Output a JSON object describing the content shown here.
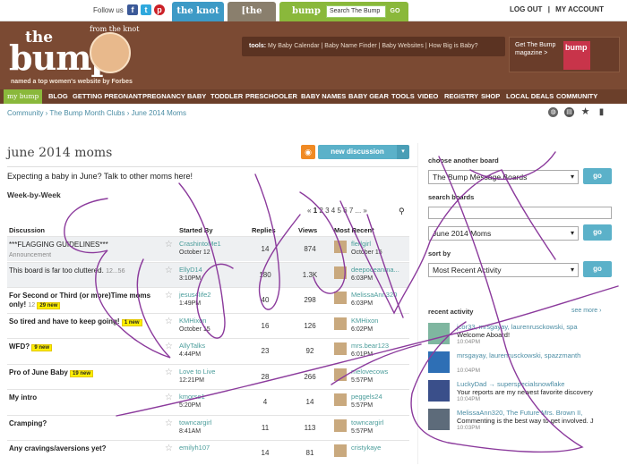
{
  "topbar": {
    "follow_us": "Follow us",
    "tabs": [
      "the knot",
      "[the nest]",
      "bump"
    ],
    "search_placeholder": "Search The Bump",
    "go": "GO",
    "logout": "LOG OUT",
    "sep": "|",
    "my_account": "MY ACCOUNT"
  },
  "header": {
    "logo_the": "the",
    "logo_bump": "bump",
    "from": "from",
    "the_knot": "the knot",
    "tagline": "named a top women's website by Forbes",
    "tools_label": "tools:",
    "tools_links": "My Baby Calendar | Baby Name Finder | Baby Websites | How Big is Baby?",
    "get_bump": "Get The Bump magazine >",
    "mag_label": "bump"
  },
  "nav": [
    "my bump",
    "BLOG",
    "GETTING PREGNANT",
    "PREGNANCY",
    "BABY",
    "TODDLER",
    "PRESCHOOLER",
    "BABY NAMES",
    "BABY GEAR",
    "TOOLS",
    "VIDEO",
    "REGISTRY",
    "SHOP",
    "LOCAL DEALS",
    "COMMUNITY"
  ],
  "breadcrumb": {
    "items": [
      "Community",
      "The Bump Month Clubs",
      "June 2014 Moms"
    ],
    "sep": " › "
  },
  "page": {
    "title": "june 2014 moms",
    "new_discussion": "new discussion",
    "tagline": "Expecting a baby in June? Talk to other moms here!",
    "week_by_week": "Week-by-Week"
  },
  "pager": {
    "prev": "«",
    "pages": [
      "1",
      "2",
      "3",
      "4",
      "5",
      "6",
      "7",
      "..."
    ],
    "next": "»"
  },
  "table": {
    "headers": [
      "Discussion",
      "Started By",
      "Replies",
      "Views",
      "Most Recent"
    ],
    "rows": [
      {
        "title": "***FLAGGING GUIDELINES***",
        "sub": "Announcement",
        "pages": "",
        "badge": "",
        "user": "CrashintoMe1",
        "date": "October 12",
        "replies": "14",
        "views": "874",
        "last_user": "flerlgirl",
        "last_date": "October 15",
        "shade": true,
        "bold": false
      },
      {
        "title": "This board is far too cluttered.",
        "sub": "",
        "pages": "12...56",
        "badge": "",
        "user": "EllyD14",
        "date": "3:10PM",
        "replies": "180",
        "views": "1.3K",
        "last_user": "deepoceanma...",
        "last_date": "6:03PM",
        "shade": true,
        "bold": false
      },
      {
        "title": "For Second or Third (or more)Time moms only!",
        "sub": "",
        "pages": "12",
        "badge": "29 new",
        "user": "jesus4life2",
        "date": "1:49PM",
        "replies": "40",
        "views": "298",
        "last_user": "MelissaAnn320",
        "last_date": "6:03PM",
        "shade": false,
        "bold": true
      },
      {
        "title": "So tired and have to keep going!",
        "sub": "",
        "pages": "",
        "badge": "1 new",
        "user": "KMHixon",
        "date": "October 15",
        "replies": "16",
        "views": "126",
        "last_user": "KMHixon",
        "last_date": "6:02PM",
        "shade": false,
        "bold": true
      },
      {
        "title": "WFD?",
        "sub": "",
        "pages": "",
        "badge": "9 new",
        "user": "AllyTalks",
        "date": "4:44PM",
        "replies": "23",
        "views": "92",
        "last_user": "mrs.bear123",
        "last_date": "6:01PM",
        "shade": false,
        "bold": true
      },
      {
        "title": "Pro of June Baby",
        "sub": "",
        "pages": "",
        "badge": "19 new",
        "user": "Love to Live",
        "date": "12:21PM",
        "replies": "28",
        "views": "266",
        "last_user": "melovecows",
        "last_date": "5:57PM",
        "shade": false,
        "bold": true
      },
      {
        "title": "My intro",
        "sub": "",
        "pages": "",
        "badge": "",
        "user": "kmorse1",
        "date": "5:20PM",
        "replies": "4",
        "views": "14",
        "last_user": "peggels24",
        "last_date": "5:57PM",
        "shade": false,
        "bold": true
      },
      {
        "title": "Cramping?",
        "sub": "",
        "pages": "",
        "badge": "",
        "user": "towncargirl",
        "date": "8:41AM",
        "replies": "11",
        "views": "113",
        "last_user": "towncargirl",
        "last_date": "5:57PM",
        "shade": false,
        "bold": true
      },
      {
        "title": "Any cravings/aversions yet?",
        "sub": "",
        "pages": "",
        "badge": "",
        "user": "emilyh107",
        "date": "",
        "replies": "14",
        "views": "81",
        "last_user": "cristykaye",
        "last_date": "",
        "shade": false,
        "bold": true
      }
    ]
  },
  "sidebar": {
    "choose_board": "choose another board",
    "board_value": "The Bump Message Boards",
    "search_boards": "search boards",
    "search_board_value": "June 2014 Moms",
    "sort_by": "sort by",
    "sort_value": "Most Recent Activity",
    "go": "go",
    "recent_activity": "recent activity",
    "see_more": "see more ›",
    "activity": [
      {
        "who": "jcor33, mrsgayay, laurenrusckowski, spa",
        "msg": "Welcome Aboard!",
        "date": "10:04PM"
      },
      {
        "who": "mrsgayay, laurenrusckowski, spazzmanth",
        "msg": "",
        "date": "10:04PM"
      },
      {
        "who": "LuckyDad → superspecialsnowflake",
        "msg": "Your reports are my newest favorite discovery",
        "date": "10:04PM"
      },
      {
        "who": "MelissaAnn320, The Future Mrs. Brown II,",
        "msg": "Commenting is the best way to get involved. J",
        "date": "10:03PM"
      }
    ]
  },
  "colors": {
    "brown": "#7b4a33",
    "green": "#8ab83b",
    "teal": "#5bb1c9",
    "scribble": "#8b3a9c"
  }
}
